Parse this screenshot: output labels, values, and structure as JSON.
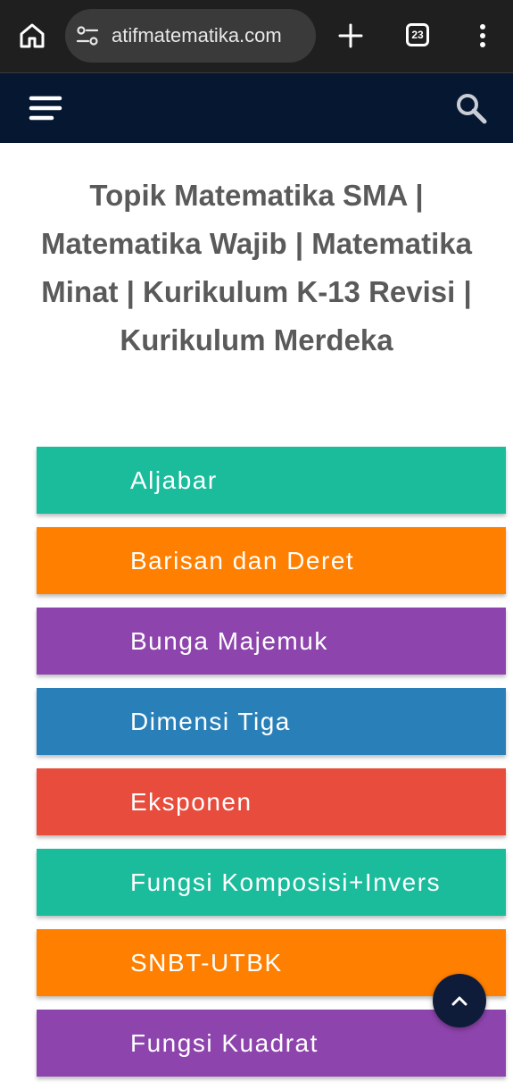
{
  "browser": {
    "url": "atifmatematika.com",
    "tab_count": "23"
  },
  "page": {
    "title": "Topik Matematika SMA | Matematika Wajib | Matematika Minat | Kurikulum K-13 Revisi | Kurikulum Merdeka"
  },
  "topics": [
    {
      "label": "Aljabar",
      "color": "#1abc9c"
    },
    {
      "label": "Barisan dan Deret",
      "color": "#ff7f00"
    },
    {
      "label": "Bunga Majemuk",
      "color": "#8e44ad"
    },
    {
      "label": "Dimensi Tiga",
      "color": "#2980b9"
    },
    {
      "label": "Eksponen",
      "color": "#e74c3c"
    },
    {
      "label": "Fungsi Komposisi+Invers",
      "color": "#1abc9c"
    },
    {
      "label": "SNBT-UTBK",
      "color": "#ff7f00"
    },
    {
      "label": "Fungsi Kuadrat",
      "color": "#8e44ad"
    }
  ],
  "icons": {
    "home": "home-icon",
    "site_settings": "tune-icon",
    "new_tab": "plus-icon",
    "tabs": "tab-switcher-icon",
    "menu": "more-vert-icon",
    "hamburger": "hamburger-menu-icon",
    "search": "search-icon",
    "back_to_top": "chevron-up-icon"
  },
  "colors": {
    "chrome_bg": "#1f1f1f",
    "header_bg": "#061731",
    "title_text": "#5a5a5a"
  }
}
